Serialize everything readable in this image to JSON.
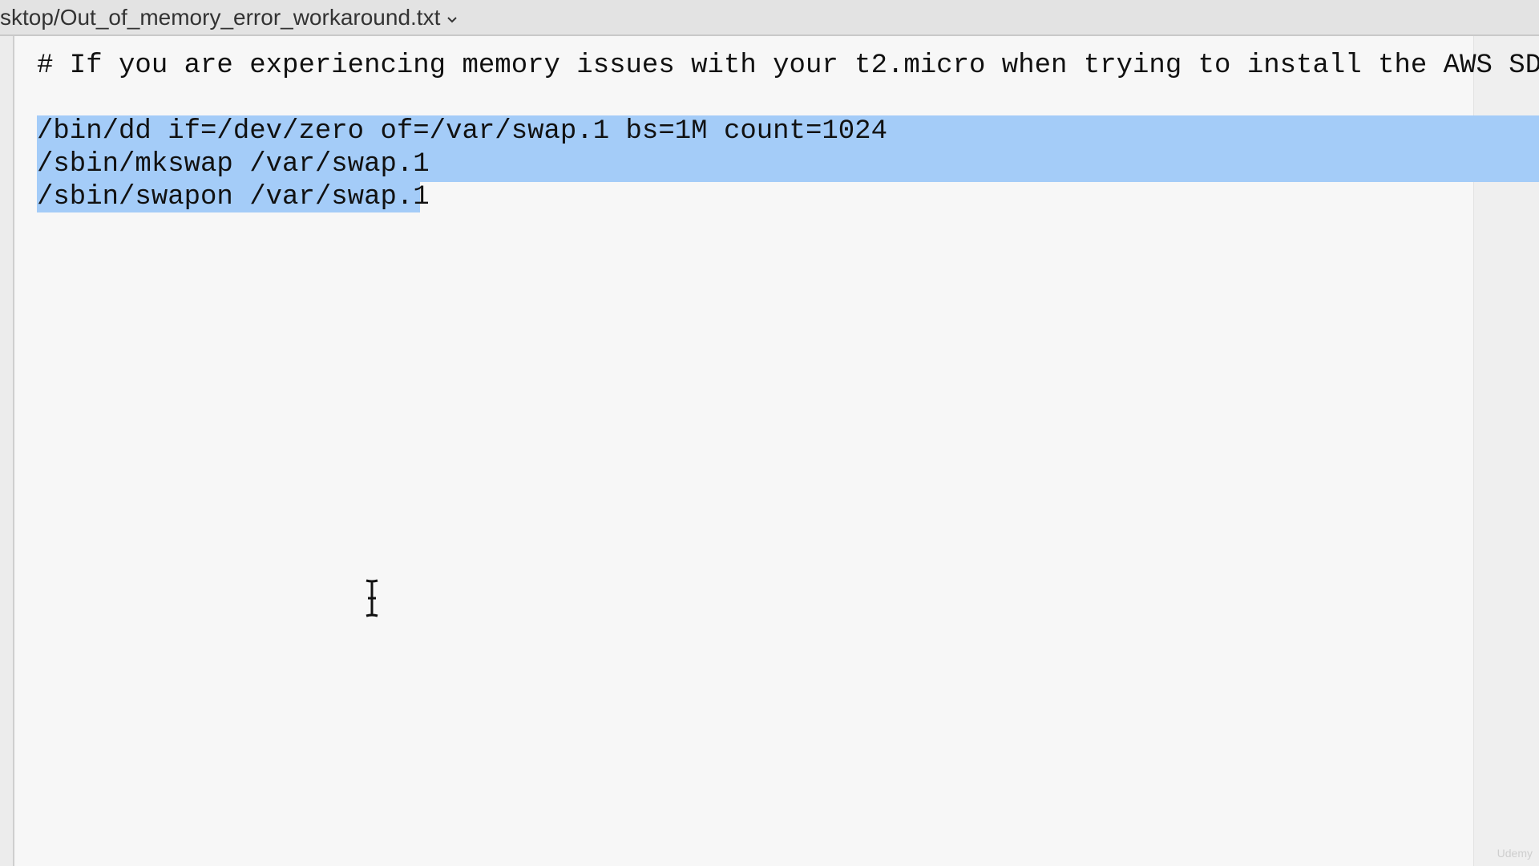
{
  "window": {
    "title_path": "sktop/Out_of_memory_error_workaround.txt"
  },
  "editor": {
    "lines": [
      "# If you are experiencing memory issues with your t2.micro when trying to install the AWS SDK,",
      "",
      "/bin/dd if=/dev/zero of=/var/swap.1 bs=1M count=1024",
      "/sbin/mkswap /var/swap.1",
      "/sbin/swapon /var/swap.1"
    ],
    "selection_color": "#a4ccf8"
  },
  "watermark": {
    "text": "Udemy"
  },
  "icons": {
    "title_dropdown": "chevron-down-icon",
    "mouse_cursor": "text-cursor-icon"
  }
}
